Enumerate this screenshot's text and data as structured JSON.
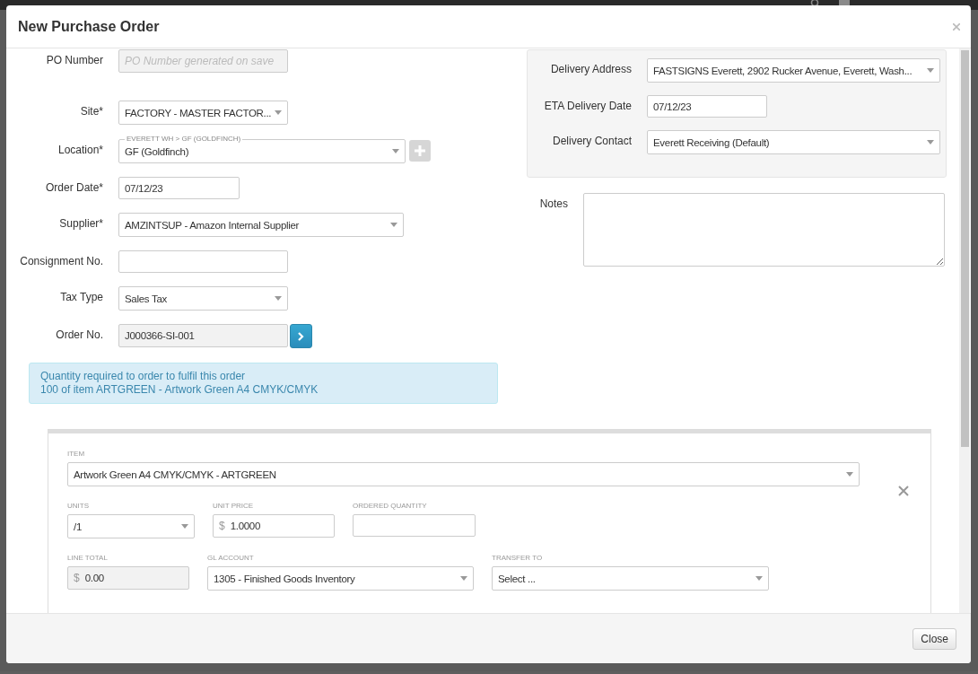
{
  "dialog": {
    "title": "New Purchase Order",
    "close_label": "Close"
  },
  "left_fields": [
    {
      "label": "PO Number",
      "kind": "readonly",
      "placeholder": "PO Number generated on save"
    },
    {
      "label": "Site*",
      "kind": "select",
      "value": "FACTORY - MASTER FACTOR..."
    },
    {
      "label": "Location*",
      "kind": "select",
      "caption": "EVERETT WH > GF (GOLDFINCH)",
      "value": "GF (Goldfinch)",
      "button": {
        "kind": "add"
      }
    },
    {
      "label": "Order Date*",
      "kind": "input",
      "value": "07/12/23"
    },
    {
      "label": "Supplier*",
      "kind": "select",
      "value": "AMZINTSUP - Amazon Internal Supplier"
    },
    {
      "label": "Consignment No.",
      "kind": "input"
    },
    {
      "label": "Tax Type",
      "kind": "select",
      "value": "Sales Tax"
    },
    {
      "label": "Order No.",
      "kind": "readonly",
      "value": "J000366-SI-001",
      "button": {
        "kind": "go"
      }
    }
  ],
  "info": [
    "Quantity required to order to fulfil this order",
    "100 of item ARTGREEN - Artwork Green A4 CMYK/CMYK"
  ],
  "delivery_fields": [
    {
      "label": "Delivery Address",
      "kind": "select",
      "value": "FASTSIGNS Everett, 2902 Rucker Avenue, Everett, Wash..."
    },
    {
      "label": "ETA Delivery Date",
      "kind": "input",
      "value": "07/12/23"
    },
    {
      "label": "Delivery Contact",
      "kind": "select",
      "value": "Everett Receiving (Default)"
    }
  ],
  "notes": {
    "label": "Notes"
  },
  "line_item": {
    "rows": [
      [
        {
          "label": "ITEM",
          "kind": "select",
          "value": "Artwork Green A4 CMYK/CMYK - ARTGREEN"
        }
      ],
      [
        {
          "label": "UNITS",
          "kind": "select",
          "value": "/1"
        },
        {
          "label": "UNIT PRICE",
          "kind": "currency",
          "disabled": false,
          "prefix": "$",
          "value": "1.0000"
        },
        {
          "label": "ORDERED QUANTITY",
          "kind": "input"
        }
      ],
      [
        {
          "label": "LINE TOTAL",
          "kind": "currency",
          "disabled": true,
          "prefix": "$",
          "value": "0.00"
        },
        {
          "label": "GL ACCOUNT",
          "kind": "select",
          "value": "1305 - Finished Goods Inventory"
        },
        {
          "label": "TRANSFER TO",
          "kind": "select",
          "value": "Select ..."
        }
      ]
    ]
  }
}
